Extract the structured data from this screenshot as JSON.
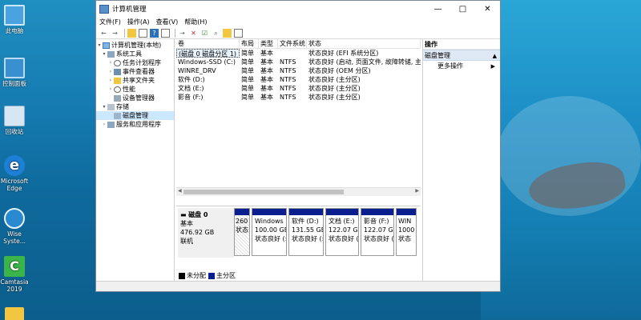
{
  "desktop": {
    "icons": [
      {
        "label": "此电脑",
        "icon": "computer-icon",
        "color": "#4aa3e0"
      },
      {
        "label": "控制面板",
        "icon": "control-panel-icon",
        "color": "#3a8fd0"
      },
      {
        "label": "回收站",
        "icon": "recycle-bin-icon",
        "color": "#d6e6f2"
      },
      {
        "label": "Microsoft Edge",
        "icon": "edge-icon",
        "color": "#1e7fd6"
      },
      {
        "label": "Wise Syste...",
        "icon": "wise-system-icon",
        "color": "#2a8ad0"
      },
      {
        "label": "Camtasia 2019",
        "icon": "camtasia-icon",
        "color": "#3bb54a"
      }
    ]
  },
  "window": {
    "title": "计算机管理",
    "controls": {
      "minimize": "—",
      "maximize": "□",
      "close": "✕"
    },
    "menu": [
      "文件(F)",
      "操作(A)",
      "查看(V)",
      "帮助(H)"
    ]
  },
  "tree": {
    "root": "计算机管理(本地)",
    "items": [
      {
        "label": "系统工具",
        "level": 1,
        "toggle": "▾"
      },
      {
        "label": "任务计划程序",
        "level": 2,
        "toggle": "›"
      },
      {
        "label": "事件查看器",
        "level": 2,
        "toggle": "›"
      },
      {
        "label": "共享文件夹",
        "level": 2,
        "toggle": "›"
      },
      {
        "label": "性能",
        "level": 2,
        "toggle": "›"
      },
      {
        "label": "设备管理器",
        "level": 2,
        "toggle": ""
      },
      {
        "label": "存储",
        "level": 1,
        "toggle": "▾"
      },
      {
        "label": "磁盘管理",
        "level": 2,
        "toggle": "",
        "selected": true
      },
      {
        "label": "服务和应用程序",
        "level": 1,
        "toggle": "›"
      }
    ]
  },
  "volumes": {
    "headers": [
      "卷",
      "布局",
      "类型",
      "文件系统",
      "状态"
    ],
    "rows": [
      {
        "name": "(磁盘 0 磁盘分区 1)",
        "layout": "简单",
        "type": "基本",
        "fs": "",
        "status": "状态良好 (EFI 系统分区)"
      },
      {
        "name": "Windows-SSD (C:)",
        "layout": "简单",
        "type": "基本",
        "fs": "NTFS",
        "status": "状态良好 (启动, 页面文件, 故障转储, 主分"
      },
      {
        "name": "WINRE_DRV",
        "layout": "简单",
        "type": "基本",
        "fs": "NTFS",
        "status": "状态良好 (OEM 分区)"
      },
      {
        "name": "软件 (D:)",
        "layout": "简单",
        "type": "基本",
        "fs": "NTFS",
        "status": "状态良好 (主分区)"
      },
      {
        "name": "文档 (E:)",
        "layout": "简单",
        "type": "基本",
        "fs": "NTFS",
        "status": "状态良好 (主分区)"
      },
      {
        "name": "影音 (F:)",
        "layout": "简单",
        "type": "基本",
        "fs": "NTFS",
        "status": "状态良好 (主分区)"
      }
    ]
  },
  "disk": {
    "name": "磁盘 0",
    "type": "基本",
    "size": "476.92 GB",
    "state": "联机",
    "partitions": [
      {
        "title": "",
        "size": "260",
        "status": "状态",
        "hatched": true
      },
      {
        "title": "Windows",
        "size": "100.00 GB",
        "status": "状态良好 (:"
      },
      {
        "title": "软件 (D:)",
        "size": "131.55 GB",
        "status": "状态良好 (:"
      },
      {
        "title": "文档 (E:)",
        "size": "122.07 GB",
        "status": "状态良好 (:"
      },
      {
        "title": "影音 (F:)",
        "size": "122.07 GB",
        "status": "状态良好 (:"
      },
      {
        "title": "WIN",
        "size": "1000",
        "status": "状态"
      }
    ]
  },
  "legend": [
    {
      "label": "未分配",
      "color": "#000000"
    },
    {
      "label": "主分区",
      "color": "#0a1f8f"
    }
  ],
  "actions": {
    "header": "操作",
    "section": "磁盘管理",
    "more": "更多操作",
    "section_arrow": "▲",
    "more_arrow": "▶"
  }
}
